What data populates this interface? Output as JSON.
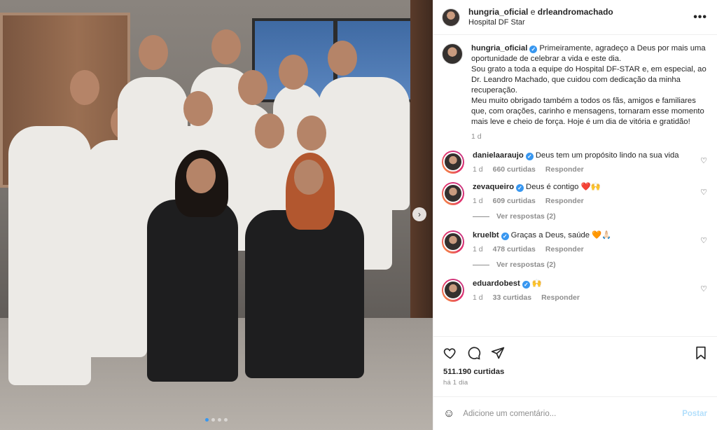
{
  "header": {
    "user1": "hungria_oficial",
    "conj": "e",
    "user2": "drleandromachado",
    "location": "Hospital DF Star",
    "more_icon": "more-horizontal-icon"
  },
  "caption": {
    "username": "hungria_oficial",
    "text": "Primeiramente, agradeço a Deus por mais uma oportunidade de celebrar a vida e este dia.\nSou grato a toda a equipe do Hospital DF-STAR e, em especial, ao Dr. Leandro Machado, que cuidou com dedicação da minha recuperação.\nMeu muito obrigado também a todos os fãs, amigos e familiares que, com orações, carinho e mensagens, tornaram esse momento mais leve e cheio de força. Hoje é um dia de vitória e gratidão!",
    "time": "1 d"
  },
  "comments": [
    {
      "user": "danielaaraujo",
      "text": "Deus tem um propósito lindo na sua vida",
      "time": "1 d",
      "likes": "660 curtidas",
      "reply": "Responder"
    },
    {
      "user": "zevaqueiro",
      "text": "Deus é contigo ❤️🙌",
      "time": "1 d",
      "likes": "609 curtidas",
      "reply": "Responder",
      "replies": "Ver respostas (2)"
    },
    {
      "user": "kruelbt",
      "text": "Graças a Deus, saúde 🧡🙏🏻",
      "time": "1 d",
      "likes": "478 curtidas",
      "reply": "Responder",
      "replies": "Ver respostas (2)"
    },
    {
      "user": "eduardobest",
      "text": "🙌",
      "time": "1 d",
      "likes": "33 curtidas",
      "reply": "Responder"
    }
  ],
  "actions": {
    "likes": "511.190 curtidas",
    "ago": "há 1 dia"
  },
  "add_comment": {
    "placeholder": "Adicione um comentário...",
    "post_label": "Postar"
  },
  "colors": {
    "verified": "#3897f0",
    "muted": "#8e8e8e",
    "post_button": "#b2dffc"
  }
}
